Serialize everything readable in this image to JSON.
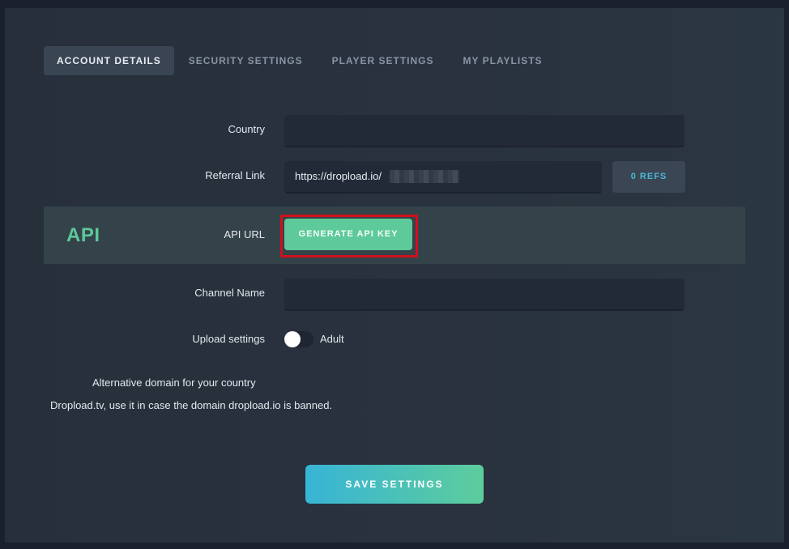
{
  "tabs": [
    {
      "label": "ACCOUNT DETAILS",
      "active": true
    },
    {
      "label": "SECURITY SETTINGS",
      "active": false
    },
    {
      "label": "PLAYER SETTINGS",
      "active": false
    },
    {
      "label": "MY PLAYLISTS",
      "active": false
    }
  ],
  "form": {
    "country": {
      "label": "Country",
      "value": ""
    },
    "referral": {
      "label": "Referral Link",
      "value": "https://dropload.io/",
      "refs_button": "0 REFS"
    },
    "api": {
      "section_title": "API",
      "label": "API URL",
      "button": "GENERATE API KEY"
    },
    "channel": {
      "label": "Channel Name",
      "value": ""
    },
    "upload": {
      "label": "Upload settings",
      "toggle_label": "Adult",
      "toggle_on": false
    }
  },
  "notes": {
    "line1": "Alternative domain for your country",
    "line2": "Dropload.tv, use it in case the domain dropload.io is banned."
  },
  "save_button": "SAVE SETTINGS",
  "colors": {
    "accent_green": "#5ec99a",
    "accent_blue": "#38b4d6",
    "highlight_red": "#d0101d"
  }
}
